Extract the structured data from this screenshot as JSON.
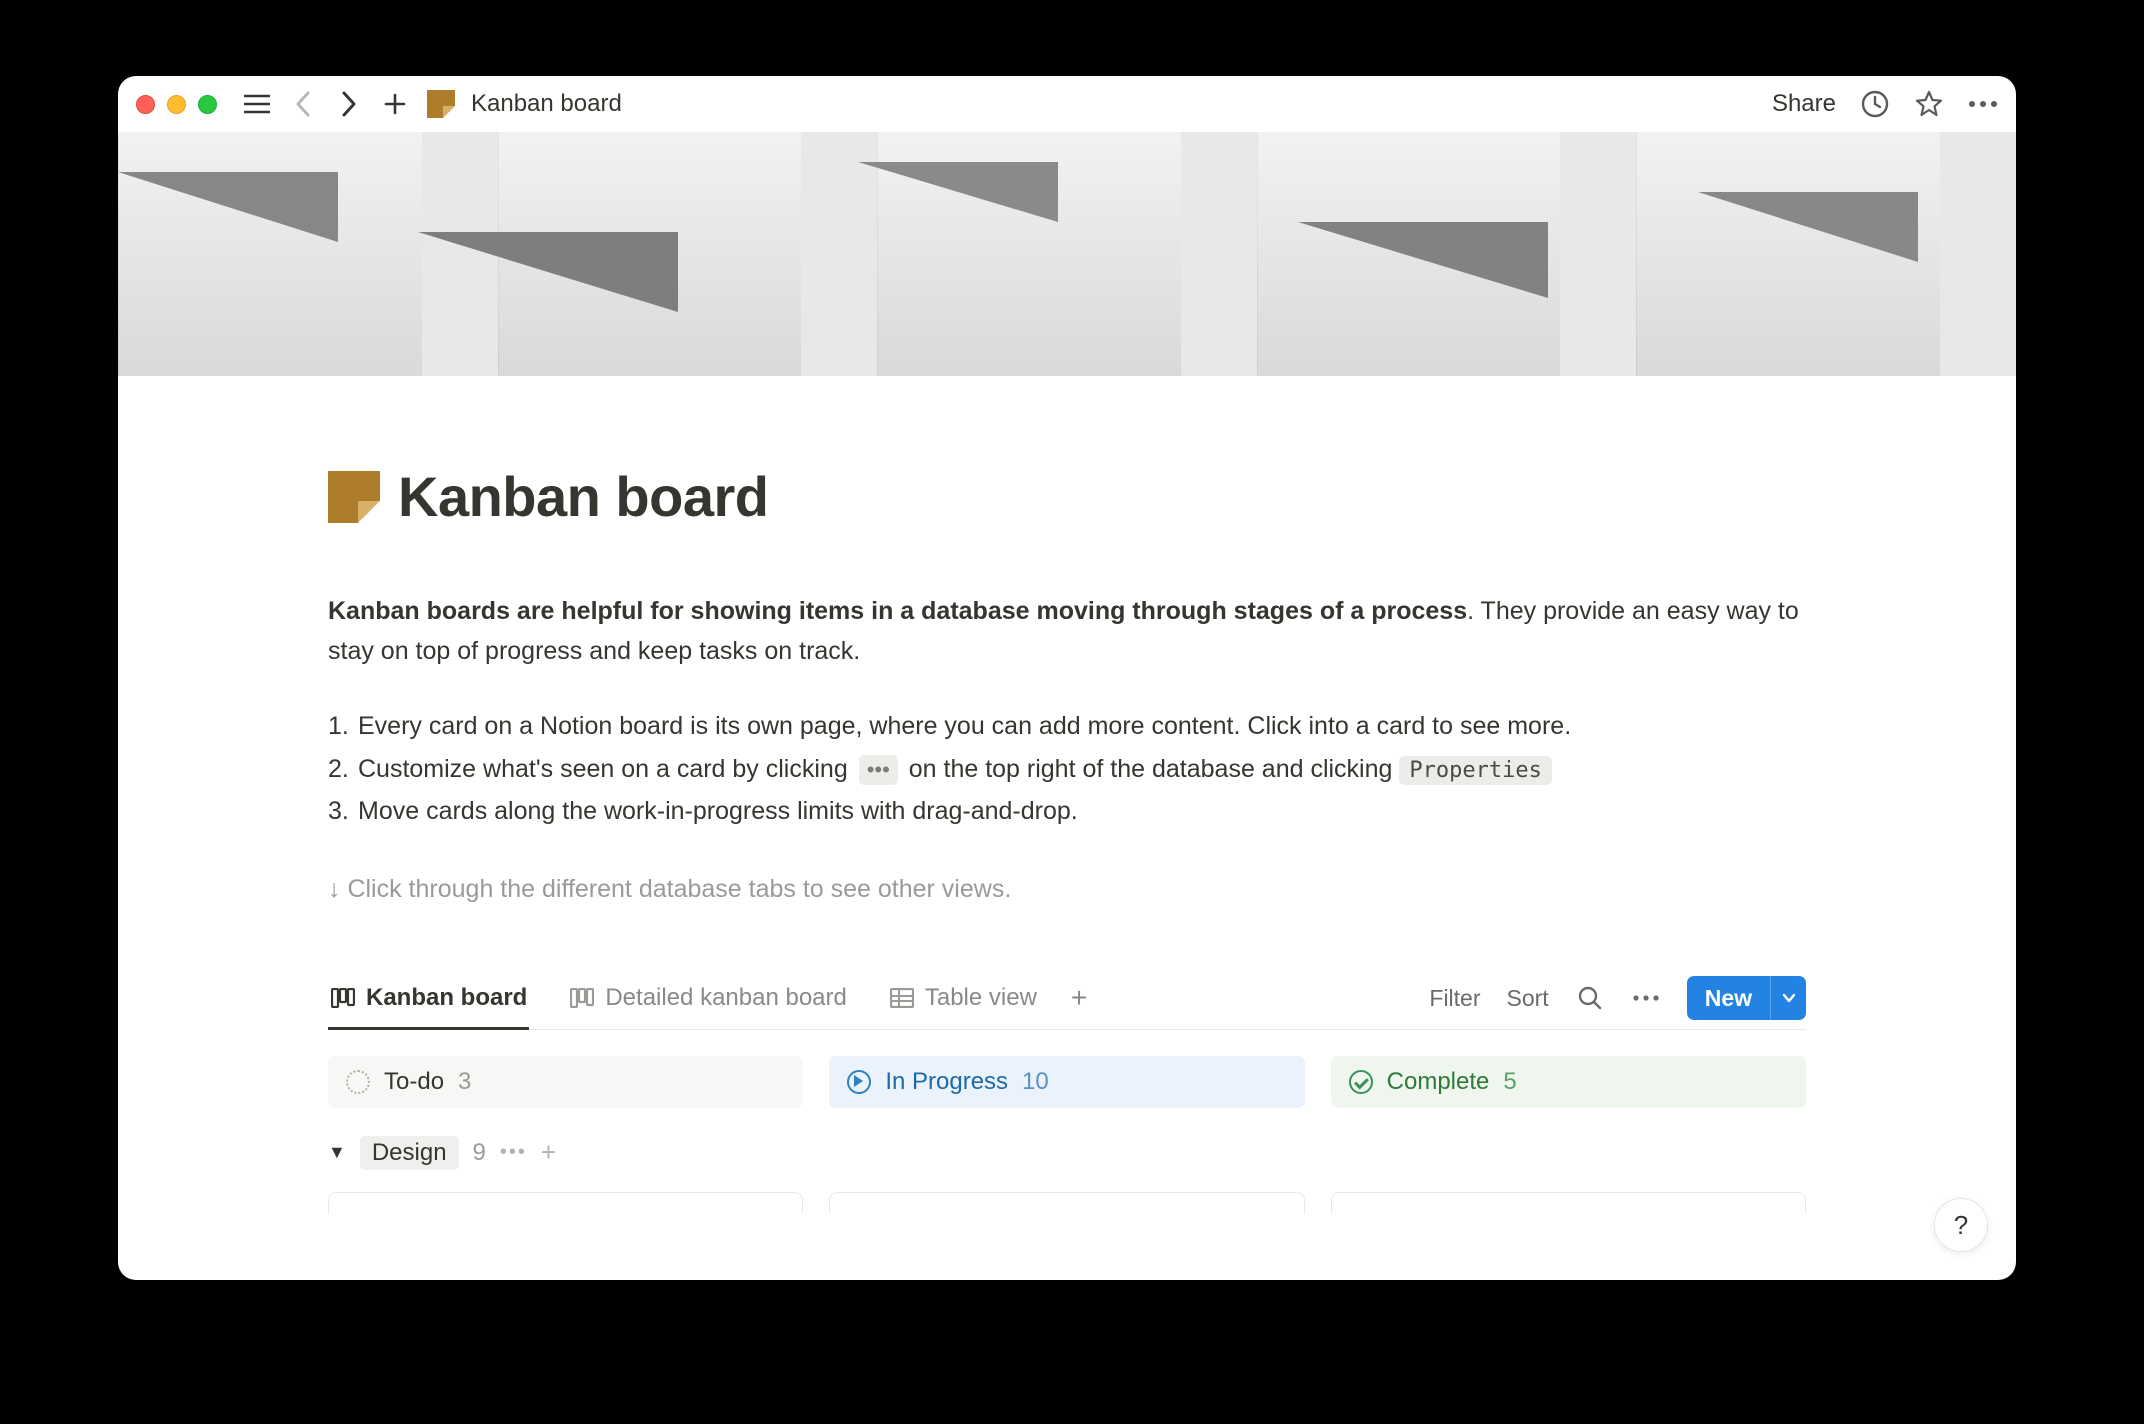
{
  "topbar": {
    "breadcrumb_title": "Kanban board",
    "share_label": "Share"
  },
  "page": {
    "title": "Kanban board",
    "intro_bold": "Kanban boards are helpful for showing items in a database moving through stages of a process",
    "intro_rest": ". They provide an easy way to stay on top of progress and keep tasks on track.",
    "list": [
      {
        "n": "1.",
        "before": "Every card on a Notion board is its own page, where you can add more content. Click into a card to see more.",
        "chip": null,
        "after": "",
        "code": null,
        "tail": ""
      },
      {
        "n": "2.",
        "before": "Customize what's seen on a card by clicking",
        "chip": "•••",
        "after": "on the top right of the database and clicking",
        "code": "Properties",
        "tail": ""
      },
      {
        "n": "3.",
        "before": "Move cards along the work-in-progress limits with drag-and-drop.",
        "chip": null,
        "after": "",
        "code": null,
        "tail": ""
      }
    ],
    "hint": "↓ Click through the different database tabs to see other views."
  },
  "database": {
    "tabs": [
      {
        "label": "Kanban board",
        "active": true,
        "icon": "board"
      },
      {
        "label": "Detailed kanban board",
        "active": false,
        "icon": "board"
      },
      {
        "label": "Table view",
        "active": false,
        "icon": "table"
      }
    ],
    "actions": {
      "filter": "Filter",
      "sort": "Sort",
      "new_label": "New"
    },
    "columns": [
      {
        "label": "To-do",
        "count": "3",
        "kind": "todo"
      },
      {
        "label": "In Progress",
        "count": "10",
        "kind": "progress"
      },
      {
        "label": "Complete",
        "count": "5",
        "kind": "complete"
      }
    ],
    "group": {
      "label": "Design",
      "count": "9"
    }
  },
  "help": "?"
}
